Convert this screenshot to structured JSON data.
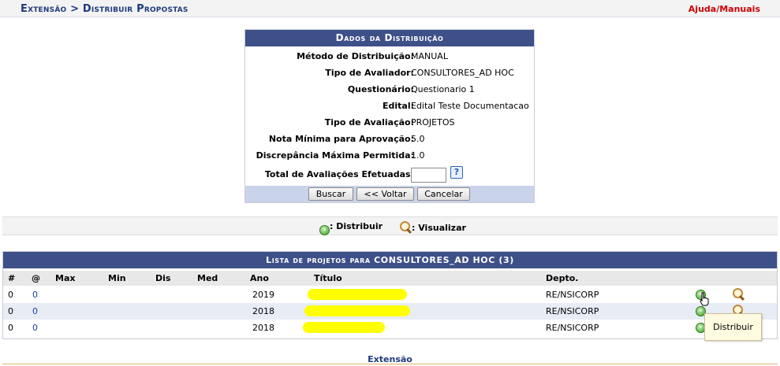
{
  "header": {
    "breadcrumb": "Extensão > Distribuir Propostas",
    "help": "Ajuda/Manuais"
  },
  "distribution": {
    "title": "Dados da Distribuição",
    "fields": [
      {
        "label": "Método de Distribuição:",
        "value": "MANUAL"
      },
      {
        "label": "Tipo de Avaliador:",
        "value": "CONSULTORES_AD HOC"
      },
      {
        "label": "Questionário:",
        "value": "Questionario 1"
      },
      {
        "label": "Edital:",
        "value": "Edital Teste Documentacao"
      },
      {
        "label": "Tipo de Avaliação:",
        "value": "PROJETOS"
      },
      {
        "label": "Nota Mínima para Aprovação:",
        "value": "5.0"
      },
      {
        "label": "Discrepância Máxima Permitida:",
        "value": "1.0"
      }
    ],
    "total_label": "Total de Avaliações Efetuadas:",
    "total_value": "",
    "help_icon": "?",
    "buttons": {
      "search": "Buscar",
      "back": "<< Voltar",
      "cancel": "Cancelar"
    }
  },
  "legend": {
    "distribute": ": Distribuir",
    "view": ": Visualizar"
  },
  "list": {
    "title": "Lista de projetos para CONSULTORES_AD HOC (3)",
    "columns": [
      "#",
      "@",
      "Max",
      "Min",
      "Dis",
      "Med",
      "Ano",
      "Título",
      "Depto."
    ],
    "rows": [
      {
        "num": "0",
        "at": "0",
        "ano": "2019",
        "depto": "RE/NSICORP"
      },
      {
        "num": "0",
        "at": "0",
        "ano": "2018",
        "depto": "RE/NSICORP"
      },
      {
        "num": "0",
        "at": "0",
        "ano": "2018",
        "depto": "RE/NSICORP"
      }
    ]
  },
  "tooltip": "Distribuir",
  "footer": "Extensão",
  "colors": {
    "header_blue": "#3e5088",
    "link_red": "#cc0000",
    "redaction": "#ffff00"
  }
}
